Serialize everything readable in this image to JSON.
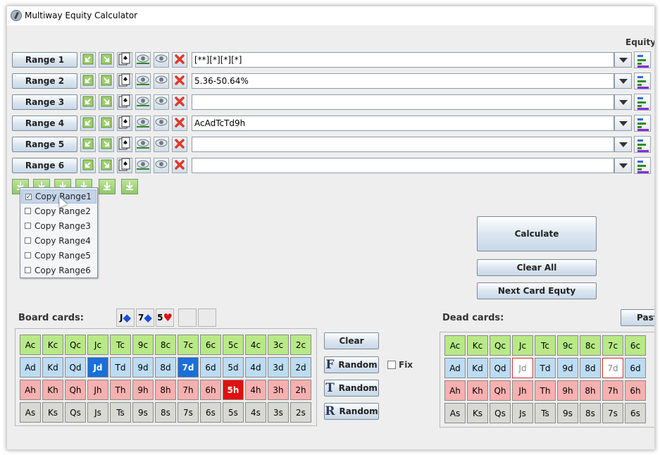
{
  "window": {
    "title": "Multiway Equity Calculator"
  },
  "equity_label": "Equity:",
  "ranges": [
    {
      "label": "Range 1",
      "value": "[**][*][*][*]"
    },
    {
      "label": "Range 2",
      "value": "5.36-50.64%"
    },
    {
      "label": "Range 3",
      "value": ""
    },
    {
      "label": "Range 4",
      "value": "AcAdTcTd9h"
    },
    {
      "label": "Range 5",
      "value": ""
    },
    {
      "label": "Range 6",
      "value": ""
    }
  ],
  "copy_menu": [
    {
      "label": "Copy Range1",
      "checked": true
    },
    {
      "label": "Copy Range2",
      "checked": false
    },
    {
      "label": "Copy Range3",
      "checked": false
    },
    {
      "label": "Copy Range4",
      "checked": false
    },
    {
      "label": "Copy Range5",
      "checked": false
    },
    {
      "label": "Copy Range6",
      "checked": false
    }
  ],
  "buttons": {
    "calculate": "Calculate",
    "clear_all": "Clear All",
    "next_card": "Next Card Equty",
    "clear": "Clear",
    "random": "Random",
    "fix": "Fix",
    "paste": "Past"
  },
  "random_letters": [
    "F",
    "T",
    "R"
  ],
  "board": {
    "label": "Board cards:",
    "selected": [
      {
        "rank": "J",
        "suit": "◆",
        "color": "#1a4fd6"
      },
      {
        "rank": "7",
        "suit": "◆",
        "color": "#1a4fd6"
      },
      {
        "rank": "5",
        "suit": "♥",
        "color": "#e01010"
      }
    ]
  },
  "dead": {
    "label": "Dead cards:"
  },
  "deck": {
    "clubs": [
      "Ac",
      "Kc",
      "Qc",
      "Jc",
      "Tc",
      "9c",
      "8c",
      "7c",
      "6c",
      "5c",
      "4c",
      "3c",
      "2c"
    ],
    "diamonds": [
      "Ad",
      "Kd",
      "Qd",
      "Jd",
      "Td",
      "9d",
      "8d",
      "7d",
      "6d",
      "5d",
      "4d",
      "3d",
      "2d"
    ],
    "hearts": [
      "Ah",
      "Kh",
      "Qh",
      "Jh",
      "Th",
      "9h",
      "8h",
      "7h",
      "6h",
      "5h",
      "4h",
      "3h",
      "2h"
    ],
    "spades": [
      "As",
      "Ks",
      "Qs",
      "Js",
      "Ts",
      "9s",
      "8s",
      "7s",
      "6s",
      "5s",
      "4s",
      "3s",
      "2s"
    ]
  },
  "dead_deck": {
    "clubs": [
      "Ac",
      "Kc",
      "Qc",
      "Jc",
      "Tc",
      "9c",
      "8c",
      "7c",
      "6c"
    ],
    "diamonds": [
      "Ad",
      "Kd",
      "Qd",
      "Jd",
      "Td",
      "9d",
      "8d",
      "7d",
      "6d"
    ],
    "hearts": [
      "Ah",
      "Kh",
      "Qh",
      "Jh",
      "Th",
      "9h",
      "8h",
      "7h",
      "6h"
    ],
    "spades": [
      "As",
      "Ks",
      "Qs",
      "Js",
      "Ts",
      "9s",
      "8s",
      "7s",
      "6s"
    ]
  },
  "colors": {
    "range_bar": "#2e8b22",
    "clubs": "#b8e986",
    "diamonds": "#bcdcf4",
    "hearts": "#f7b0b0",
    "spades": "#d9d9d4",
    "selected_diamond": "#1a6fdb",
    "selected_heart": "#e01010"
  }
}
